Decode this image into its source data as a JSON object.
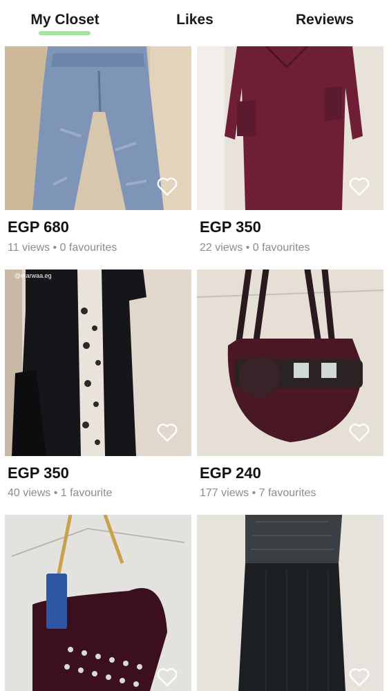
{
  "tabs": [
    {
      "label": "My Closet",
      "active": true
    },
    {
      "label": "Likes",
      "active": false
    },
    {
      "label": "Reviews",
      "active": false
    }
  ],
  "accent_color": "#a3e6a0",
  "items": [
    {
      "price": "EGP 680",
      "stats": "11 views • 0 favourites",
      "subject": "jeans"
    },
    {
      "price": "EGP 350",
      "stats": "22 views • 0 favourites",
      "subject": "burgundy-dress"
    },
    {
      "price": "EGP 350",
      "stats": "40 views • 1 favourite",
      "subject": "black-cardigan",
      "watermark": "@marwaa.eg"
    },
    {
      "price": "EGP 240",
      "stats": "177 views • 7 favourites",
      "subject": "velvet-handbag"
    },
    {
      "subject": "studded-velvet-bag"
    },
    {
      "subject": "black-knit-dress"
    }
  ],
  "icons": {
    "heart": "heart-outline-icon"
  }
}
